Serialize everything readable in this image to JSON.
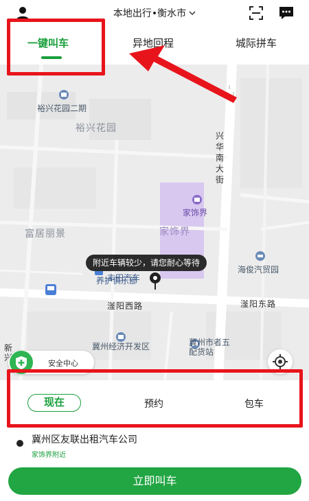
{
  "header": {
    "city": "本地出行•衡水市",
    "icons": {
      "user": "user-icon",
      "scan": "scan-icon",
      "message": "message-icon",
      "chevron": "chevron-down-icon"
    }
  },
  "tabs": [
    {
      "label": "一键叫车",
      "active": true
    },
    {
      "label": "异地回程",
      "active": false
    },
    {
      "label": "城际拼车",
      "active": false
    }
  ],
  "map": {
    "pois": [
      {
        "label": "裕兴花园二期",
        "icon": "building-pin-icon"
      },
      {
        "label": "家饰界",
        "icon": "shopping-pin-icon"
      },
      {
        "label": "海俊汽贸园",
        "icon": "car-pin-icon"
      },
      {
        "label": "冀州经济开发区",
        "icon": "office-pin-icon"
      },
      {
        "label": "冀州市者五配货站",
        "icon": "logistics-pin-icon"
      }
    ],
    "areas": [
      "裕兴花园",
      "富居丽景",
      "家饰界"
    ],
    "roads": [
      "兴华南大街",
      "滏阳西路",
      "滏阳东路",
      "新兴"
    ],
    "partial_poi": "养护俱乐部",
    "partial_poi_top": "丰田汽车",
    "hint": "附近车辆较少，请您耐心等待",
    "safety_center": "安全中心",
    "colors": {
      "highlight_block": "#d8c8f0",
      "accent": "#1a9f3c"
    }
  },
  "booking": {
    "time_options": [
      {
        "label": "现在",
        "selected": true
      },
      {
        "label": "预约",
        "selected": false
      },
      {
        "label": "包车",
        "selected": false
      }
    ],
    "pickup": {
      "name": "冀州区友联出租汽车公司",
      "sub": "家饰界附近"
    },
    "cta": "立即叫车"
  }
}
